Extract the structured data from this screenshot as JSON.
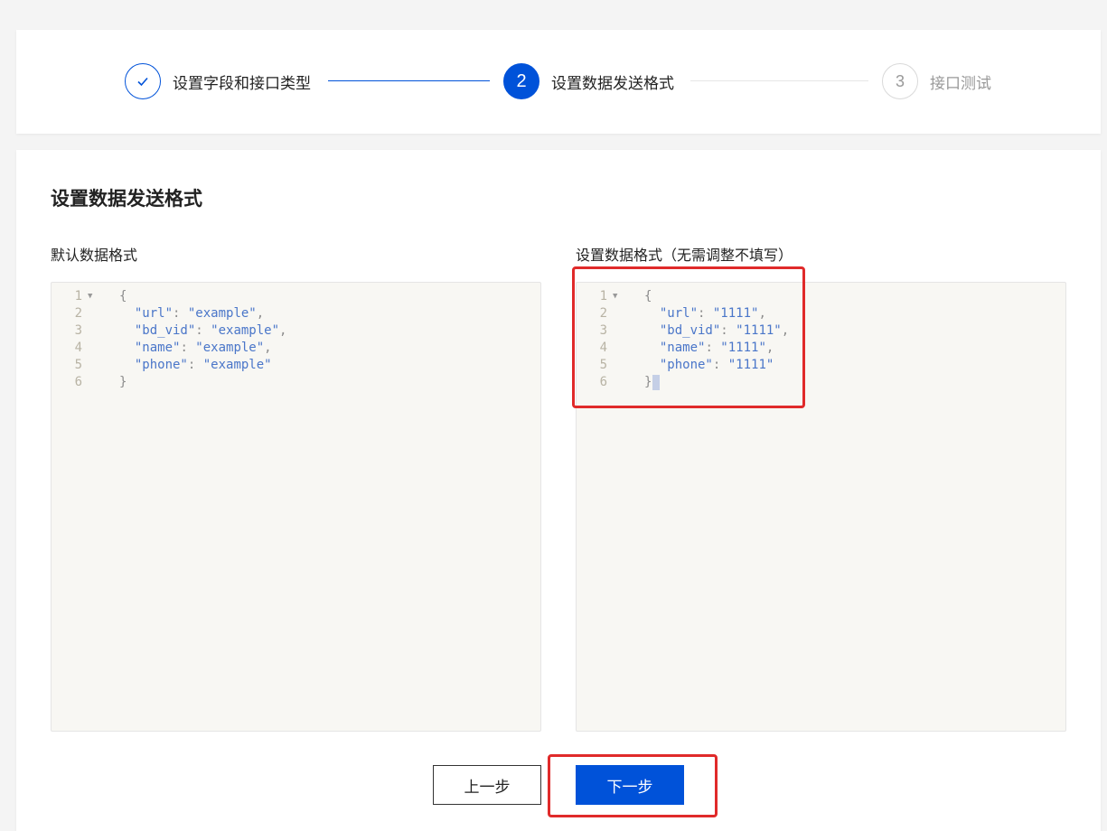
{
  "steps": [
    {
      "index": "1",
      "label": "设置字段和接口类型",
      "status": "done",
      "icon": "check-icon"
    },
    {
      "index": "2",
      "label": "设置数据发送格式",
      "status": "active"
    },
    {
      "index": "3",
      "label": "接口测试",
      "status": "todo"
    }
  ],
  "section": {
    "title": "设置数据发送格式"
  },
  "default_editor": {
    "label": "默认数据格式",
    "lines": [
      {
        "num": "1",
        "text": "{"
      },
      {
        "num": "2",
        "key": "\"url\"",
        "value": "\"example\"",
        "trail": ","
      },
      {
        "num": "3",
        "key": "\"bd_vid\"",
        "value": "\"example\"",
        "trail": ","
      },
      {
        "num": "4",
        "key": "\"name\"",
        "value": "\"example\"",
        "trail": ","
      },
      {
        "num": "5",
        "key": "\"phone\"",
        "value": "\"example\"",
        "trail": ""
      },
      {
        "num": "6",
        "text": "}"
      }
    ]
  },
  "custom_editor": {
    "label": "设置数据格式（无需调整不填写）",
    "lines": [
      {
        "num": "1",
        "text": "{"
      },
      {
        "num": "2",
        "key": "\"url\"",
        "value": "\"1111\"",
        "trail": ","
      },
      {
        "num": "3",
        "key": "\"bd_vid\"",
        "value": "\"1111\"",
        "trail": ","
      },
      {
        "num": "4",
        "key": "\"name\"",
        "value": "\"1111\"",
        "trail": ","
      },
      {
        "num": "5",
        "key": "\"phone\"",
        "value": "\"1111\"",
        "trail": ""
      },
      {
        "num": "6",
        "text": "}"
      }
    ]
  },
  "buttons": {
    "prev": "上一步",
    "next": "下一步"
  },
  "colors": {
    "primary": "#0052d9",
    "highlight": "#e02a2a"
  }
}
